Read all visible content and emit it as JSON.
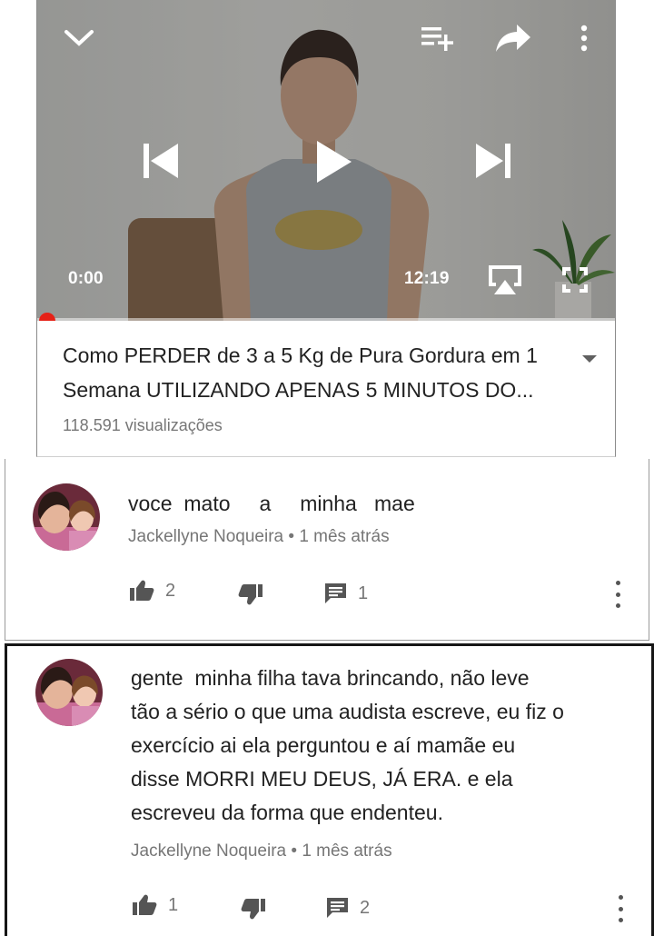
{
  "player": {
    "current_time": "0:00",
    "duration": "12:19",
    "progress_fraction": 0.0,
    "icons": {
      "collapse": "chevron-down-icon",
      "add_to_playlist": "playlist-add-icon",
      "share": "share-icon",
      "menu": "more-vert-icon",
      "previous": "skip-previous-icon",
      "play": "play-icon",
      "next": "skip-next-icon",
      "cast": "airplay-icon",
      "fullscreen": "fullscreen-icon"
    },
    "accent_color": "#e62117"
  },
  "video": {
    "title_line1": "Como PERDER de 3 a 5 Kg de Pura Gordura em 1",
    "title_line2": "Semana UTILIZANDO APENAS 5 MINUTOS DO...",
    "views": "118.591 visualizações"
  },
  "comments": [
    {
      "text": "voce  mato     a     minha   mae",
      "author": "Jackellyne Noqueira",
      "separator": "•",
      "time": "1 mês atrás",
      "likes": "2",
      "replies": "1"
    },
    {
      "lines": [
        "gente  minha filha tava brincando, não leve",
        "tão a sério o que uma audista escreve, eu fiz o",
        "exercício ai ela perguntou e aí mamãe eu",
        "disse MORRI MEU DEUS, JÁ ERA. e ela",
        "escreveu da forma que endenteu."
      ],
      "author": "Jackellyne Noqueira",
      "separator": "•",
      "time": "1 mês atrás",
      "likes": "1",
      "replies": "2"
    }
  ]
}
